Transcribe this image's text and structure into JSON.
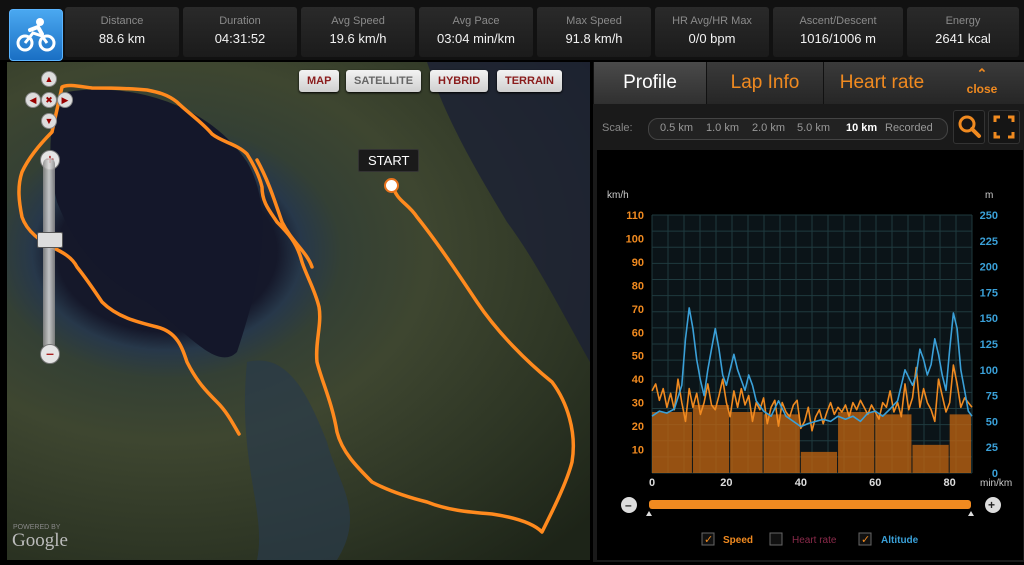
{
  "stats": [
    {
      "label": "Distance",
      "value": "88.6 km"
    },
    {
      "label": "Duration",
      "value": "04:31:52"
    },
    {
      "label": "Avg Speed",
      "value": "19.6 km/h"
    },
    {
      "label": "Avg Pace",
      "value": "03:04 min/km"
    },
    {
      "label": "Max Speed",
      "value": "91.8 km/h"
    },
    {
      "label": "HR Avg/HR Max",
      "value": "0/0 bpm"
    },
    {
      "label": "Ascent/Descent",
      "value": "1016/1006 m"
    },
    {
      "label": "Energy",
      "value": "2641 kcal"
    }
  ],
  "map": {
    "types": [
      "MAP",
      "SATELLITE",
      "HYBRID",
      "TERRAIN"
    ],
    "selected_type": "SATELLITE",
    "start_label": "START",
    "powered_by": "POWERED BY",
    "google": "Google",
    "route_color": "#ff8a1e"
  },
  "tabs": [
    {
      "label": "Profile",
      "active": true
    },
    {
      "label": "Lap Info",
      "active": false
    },
    {
      "label": "Heart rate",
      "active": false
    }
  ],
  "close_label": "close",
  "scale": {
    "label": "Scale:",
    "options": [
      "0.5 km",
      "1.0 km",
      "2.0 km",
      "5.0 km",
      "10 km",
      "Recorded"
    ],
    "selected": "10 km"
  },
  "legend": [
    {
      "label": "Speed",
      "checked": true,
      "color": "#f08a20"
    },
    {
      "label": "Heart rate",
      "checked": false,
      "color": "#8a2a4a"
    },
    {
      "label": "Altitude",
      "checked": true,
      "color": "#3aa0d8"
    }
  ],
  "chart_data": {
    "type": "line",
    "xlabel": "min/km",
    "ylabel_left": "km/h",
    "ylabel_right": "m",
    "x_ticks": [
      0,
      20,
      40,
      60,
      80
    ],
    "xlim": [
      0,
      86
    ],
    "y_left_ticks": [
      10,
      20,
      30,
      40,
      50,
      60,
      70,
      80,
      90,
      100,
      110
    ],
    "ylim_left": [
      0,
      110
    ],
    "y_right_ticks": [
      0,
      25,
      50,
      75,
      100,
      125,
      150,
      175,
      200,
      225,
      250
    ],
    "ylim_right": [
      0,
      250
    ],
    "speed_bars": [
      {
        "x0": 0,
        "x1": 11,
        "value": 26
      },
      {
        "x0": 11,
        "x1": 21,
        "value": 29
      },
      {
        "x0": 21,
        "x1": 30,
        "value": 26
      },
      {
        "x0": 30,
        "x1": 40,
        "value": 25
      },
      {
        "x0": 40,
        "x1": 50,
        "value": 9
      },
      {
        "x0": 50,
        "x1": 60,
        "value": 26
      },
      {
        "x0": 60,
        "x1": 70,
        "value": 25
      },
      {
        "x0": 70,
        "x1": 80,
        "value": 12
      },
      {
        "x0": 80,
        "x1": 86,
        "value": 25
      }
    ],
    "series": [
      {
        "name": "Speed",
        "color": "#f08a20",
        "x": [
          0,
          1,
          2,
          3,
          4,
          5,
          6,
          7,
          8,
          9,
          10,
          11,
          12,
          13,
          14,
          15,
          16,
          17,
          18,
          19,
          20,
          21,
          22,
          23,
          24,
          25,
          26,
          27,
          28,
          29,
          30,
          31,
          32,
          33,
          34,
          35,
          36,
          37,
          38,
          39,
          40,
          41,
          42,
          43,
          44,
          45,
          46,
          47,
          48,
          49,
          50,
          51,
          52,
          53,
          54,
          55,
          56,
          57,
          58,
          59,
          60,
          61,
          62,
          63,
          64,
          65,
          66,
          67,
          68,
          69,
          70,
          71,
          72,
          73,
          74,
          75,
          76,
          77,
          78,
          79,
          80,
          81,
          82,
          83,
          84,
          85,
          86
        ],
        "y": [
          35,
          38,
          31,
          36,
          28,
          34,
          27,
          40,
          30,
          22,
          36,
          28,
          34,
          25,
          30,
          38,
          29,
          27,
          33,
          40,
          30,
          24,
          35,
          28,
          36,
          29,
          33,
          22,
          30,
          27,
          32,
          21,
          28,
          31,
          20,
          30,
          26,
          24,
          29,
          31,
          19,
          22,
          28,
          18,
          24,
          27,
          21,
          26,
          30,
          25,
          28,
          26,
          29,
          24,
          30,
          27,
          31,
          28,
          25,
          29,
          26,
          23,
          30,
          28,
          35,
          26,
          30,
          24,
          38,
          27,
          32,
          45,
          28,
          36,
          30,
          27,
          22,
          40,
          33,
          26,
          30,
          46,
          38,
          28,
          32,
          30,
          28
        ]
      },
      {
        "name": "Altitude",
        "color": "#3aa0d8",
        "x": [
          0,
          2,
          4,
          6,
          8,
          9,
          10,
          11,
          12,
          13,
          14,
          15,
          16,
          17,
          18,
          19,
          20,
          21,
          22,
          23,
          24,
          25,
          26,
          27,
          28,
          29,
          30,
          32,
          34,
          36,
          38,
          40,
          42,
          44,
          46,
          48,
          50,
          52,
          54,
          56,
          58,
          60,
          62,
          64,
          66,
          68,
          70,
          71,
          72,
          73,
          74,
          75,
          76,
          77,
          78,
          79,
          80,
          81,
          82,
          83,
          84,
          85,
          86
        ],
        "y": [
          55,
          60,
          58,
          62,
          85,
          130,
          160,
          140,
          110,
          90,
          75,
          100,
          120,
          140,
          120,
          95,
          85,
          100,
          115,
          100,
          90,
          80,
          95,
          85,
          70,
          65,
          60,
          55,
          70,
          55,
          50,
          45,
          48,
          50,
          52,
          50,
          55,
          52,
          55,
          50,
          58,
          60,
          55,
          62,
          70,
          100,
          85,
          95,
          120,
          110,
          95,
          105,
          130,
          115,
          95,
          80,
          120,
          155,
          140,
          100,
          80,
          60,
          55
        ]
      }
    ]
  }
}
